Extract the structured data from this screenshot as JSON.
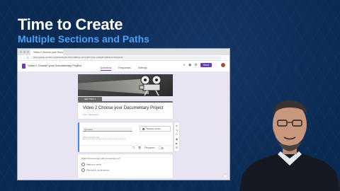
{
  "slide": {
    "title": "Time to Create",
    "subtitle": "Multiple Sections and Paths"
  },
  "browser": {
    "tab_title": "Video 2 Choose your Documentary Project",
    "url": "docs.google.com/forms/d/e/1FAIpQLSfVmx0B9ca-xDn7yE5Y7jH1-o4h0g5L6cBrDH1-WwQ/edit"
  },
  "form": {
    "name": "Video 2 Choose your Documentary Project",
    "send_label": "Send",
    "tabs": [
      {
        "label": "Questions"
      },
      {
        "label": "Responses"
      },
      {
        "label": "Settings"
      }
    ],
    "section_label": "SECTION 1",
    "title": "Video 2 Choose your Documentary Project",
    "description": "Form description",
    "question": {
      "input_placeholder": "Question",
      "type_label": "Multiple choice",
      "short_answer": "Short answer text",
      "required_label": "Required"
    },
    "question2": {
      "text": "Which Documentary will you working on?",
      "options": [
        "Making a movie",
        "Planning a documentary"
      ]
    }
  },
  "colors": {
    "slide_background": "#0b2a52",
    "subtitle": "#4d9ff5",
    "forms_accent": "#673ab7",
    "editor_background": "#e9e4f2"
  }
}
